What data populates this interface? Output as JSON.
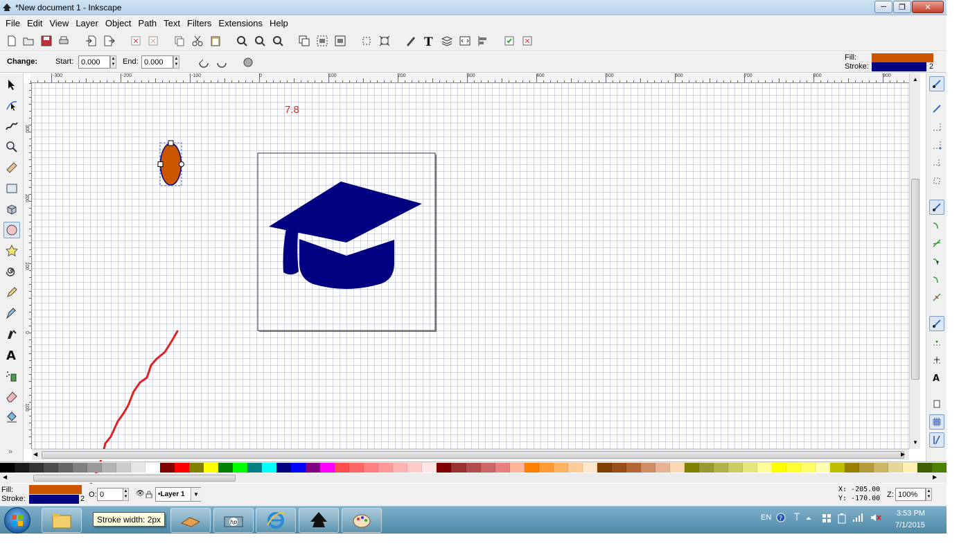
{
  "window": {
    "title": "*New document 1 - Inkscape",
    "minimize": "─",
    "maximize": "❐",
    "close": "✕"
  },
  "menu": [
    "File",
    "Edit",
    "View",
    "Layer",
    "Object",
    "Path",
    "Text",
    "Filters",
    "Extensions",
    "Help"
  ],
  "tool_controls": {
    "change_label": "Change:",
    "start_label": "Start:",
    "start_value": "0.000",
    "end_label": "End:",
    "end_value": "0.000"
  },
  "style_indicator_top": {
    "fill_label": "Fill:",
    "stroke_label": "Stroke:",
    "stroke_width": "2",
    "fill_color": "#cc5500",
    "stroke_color": "#000080"
  },
  "ruler": {
    "top": [
      "-300",
      "-200",
      "-100",
      "0",
      "100",
      "200",
      "300",
      "400",
      "500",
      "600",
      "700",
      "800",
      "900"
    ],
    "left": [
      "300",
      "200",
      "100",
      "0",
      "100"
    ]
  },
  "canvas": {
    "annotation_text": "7.8",
    "annotation_color": "#dd2222",
    "ellipse_fill": "#cc5500",
    "ellipse_stroke": "#000080",
    "cap_color": "#000080",
    "page_border": "#333333"
  },
  "palette": [
    "#000000",
    "#1a1a1a",
    "#333333",
    "#4d4d4d",
    "#666666",
    "#808080",
    "#999999",
    "#b3b3b3",
    "#cccccc",
    "#e6e6e6",
    "#ffffff",
    "#800000",
    "#ff0000",
    "#808000",
    "#ffff00",
    "#008000",
    "#00ff00",
    "#008080",
    "#00ffff",
    "#000080",
    "#0000ff",
    "#800080",
    "#ff00ff",
    "#ff4d4d",
    "#ff6666",
    "#ff8080",
    "#ff9999",
    "#ffb3b3",
    "#ffcccc",
    "#ffe6e6",
    "#800000",
    "#993333",
    "#b34d4d",
    "#cc6666",
    "#e68080",
    "#ffb399",
    "#ff8000",
    "#ff9933",
    "#ffb366",
    "#ffcc99",
    "#ffe6cc",
    "#804000",
    "#994d1a",
    "#b36633",
    "#cc8c66",
    "#e6b399",
    "#ffd9b3",
    "#808000",
    "#999933",
    "#b3b34d",
    "#cccc66",
    "#e6e680",
    "#ffff99",
    "#ffff00",
    "#ffff33",
    "#ffff66",
    "#ffffb3",
    "#bfbf00",
    "#998000",
    "#b39b3d",
    "#ccb566",
    "#e6d699",
    "#fff0b3",
    "#406000",
    "#4d8000"
  ],
  "status": {
    "fill_label": "Fill:",
    "stroke_label": "Stroke:",
    "stroke_width": "2",
    "opacity_label": "O:",
    "opacity_value": "0",
    "layer_name": "•Layer 1",
    "x_coord": "X: -205.00",
    "y_coord": "Y: -170.00",
    "zoom_label": "Z:",
    "zoom_value": "100%",
    "fill_color": "#cc5500",
    "stroke_color": "#000080"
  },
  "tooltip": "Stroke width: 2px",
  "tray": {
    "language": "EN",
    "time": "3:53 PM",
    "date": "7/1/2015"
  }
}
